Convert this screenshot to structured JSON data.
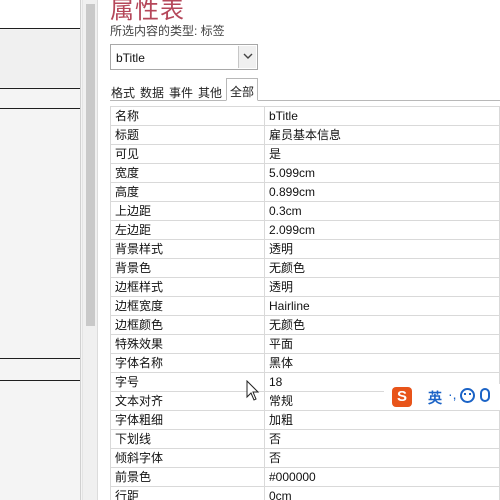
{
  "panel": {
    "title": "属性表",
    "selection_label": "所选内容的类型: 标签"
  },
  "object_select": {
    "value": "bTitle"
  },
  "tabs": [
    {
      "label": "格式",
      "active": false
    },
    {
      "label": "数据",
      "active": false
    },
    {
      "label": "事件",
      "active": false
    },
    {
      "label": "其他",
      "active": false
    },
    {
      "label": "全部",
      "active": true
    }
  ],
  "properties": [
    {
      "name": "名称",
      "value": "bTitle"
    },
    {
      "name": "标题",
      "value": "雇员基本信息"
    },
    {
      "name": "可见",
      "value": "是"
    },
    {
      "name": "宽度",
      "value": "5.099cm"
    },
    {
      "name": "高度",
      "value": "0.899cm"
    },
    {
      "name": "上边距",
      "value": "0.3cm"
    },
    {
      "name": "左边距",
      "value": "2.099cm"
    },
    {
      "name": "背景样式",
      "value": "透明"
    },
    {
      "name": "背景色",
      "value": "无颜色"
    },
    {
      "name": "边框样式",
      "value": "透明"
    },
    {
      "name": "边框宽度",
      "value": "Hairline"
    },
    {
      "name": "边框颜色",
      "value": "无颜色"
    },
    {
      "name": "特殊效果",
      "value": "平面"
    },
    {
      "name": "字体名称",
      "value": "黑体"
    },
    {
      "name": "字号",
      "value": "18"
    },
    {
      "name": "文本对齐",
      "value": "常规"
    },
    {
      "name": "字体粗细",
      "value": "加粗"
    },
    {
      "name": "下划线",
      "value": "否"
    },
    {
      "name": "倾斜字体",
      "value": "否"
    },
    {
      "name": "前景色",
      "value": "#000000"
    },
    {
      "name": "行距",
      "value": "0cm"
    }
  ],
  "ime": {
    "logo": "S",
    "lang": "英",
    "punct": "·,"
  },
  "colors": {
    "title": "#b5475a",
    "ime_blue": "#1b63c6",
    "ime_logo": "#e8541a"
  }
}
